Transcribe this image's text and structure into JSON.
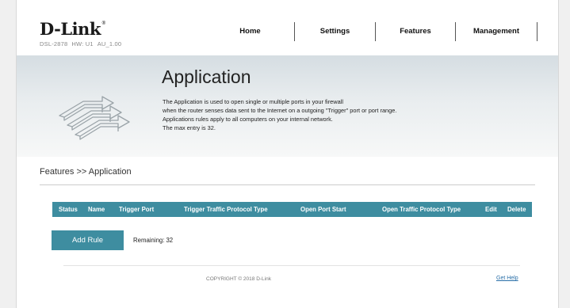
{
  "brand": {
    "name": "D-Link",
    "reg_mark": "®",
    "model": "DSL-2878",
    "hw": "HW: U1",
    "fw": "AU_1.00"
  },
  "nav": {
    "home": "Home",
    "settings": "Settings",
    "features": "Features",
    "management": "Management"
  },
  "banner": {
    "title": "Application",
    "icon": "application-arrows-icon",
    "description": [
      "The Application is used to open single or multiple ports in your firewall",
      "when the router senses data sent to the Internet on a outgoing \"Trigger\" port or port range.",
      "Applications rules apply to all computers on your internal network.",
      "The max entry is 32."
    ]
  },
  "breadcrumb": "Features >> Application",
  "table": {
    "columns": [
      "Status",
      "Name",
      "Trigger Port",
      "Trigger Traffic Protocol Type",
      "Open Port Start",
      "Open Traffic Protocol Type",
      "Edit",
      "Delete"
    ],
    "rows": []
  },
  "actions": {
    "add_rule": "Add Rule",
    "remaining_label": "Remaining:",
    "remaining_count": "32"
  },
  "footer": {
    "copyright": "COPYRIGHT © 2018 D-Link",
    "help": "Get Help"
  },
  "colors": {
    "accent": "#3e8da0",
    "link": "#2a6fa8"
  }
}
